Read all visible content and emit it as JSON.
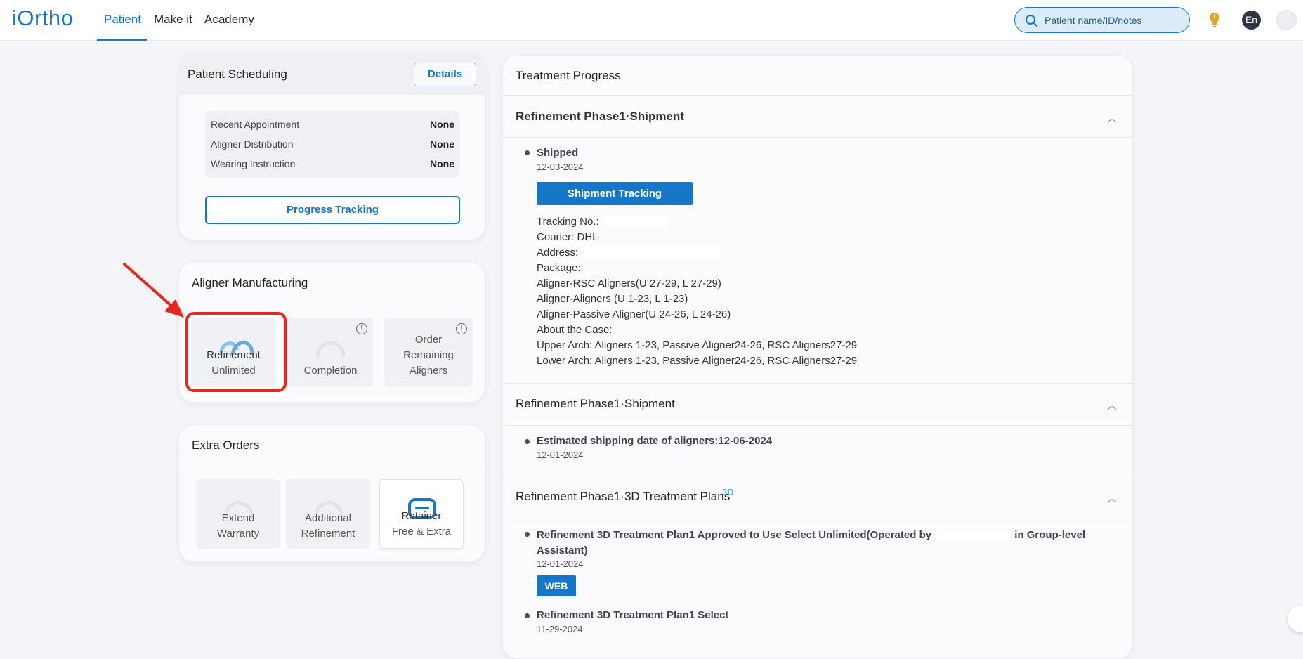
{
  "nav": {
    "logo": "iOrtho",
    "items": [
      "Patient",
      "Make it",
      "Academy"
    ],
    "search_placeholder": "Patient name/ID/notes",
    "lang": "En"
  },
  "scheduling": {
    "title": "Patient Scheduling",
    "details": "Details",
    "rows": [
      {
        "label": "Recent Appointment",
        "value": "None"
      },
      {
        "label": "Aligner Distribution",
        "value": "None"
      },
      {
        "label": "Wearing Instruction",
        "value": "None"
      }
    ],
    "progress_button": "Progress Tracking"
  },
  "manufacturing": {
    "title": "Aligner Manufacturing",
    "tiles": [
      {
        "line1": "Refinement",
        "line2": "Unlimited"
      },
      {
        "line1": "Completion"
      },
      {
        "line1": "Order",
        "line2": "Remaining",
        "line3": "Aligners"
      }
    ]
  },
  "extra": {
    "title": "Extra Orders",
    "tiles": [
      {
        "line1": "Extend",
        "line2": "Warranty"
      },
      {
        "line1": "Additional",
        "line2": "Refinement"
      },
      {
        "line1": "Retainer",
        "line2": "Free & Extra"
      }
    ]
  },
  "progress": {
    "title": "Treatment Progress",
    "sections": [
      {
        "title": "Refinement Phase1·Shipment",
        "event": "Shipped",
        "date": "12-03-2024",
        "button": "Shipment Tracking",
        "lines": {
          "tracking": "Tracking No.:",
          "courier": "Courier: DHL",
          "address": "Address:",
          "package": "Package:",
          "p1": "Aligner-RSC Aligners(U 27-29, L 27-29)",
          "p2": "Aligner-Aligners (U 1-23, L 1-23)",
          "p3": "Aligner-Passive Aligner(U 24-26, L 24-26)",
          "about": "About the Case:",
          "upper": "Upper Arch: Aligners 1-23, Passive Aligner24-26, RSC Aligners27-29",
          "lower": "Lower Arch: Aligners 1-23, Passive Aligner24-26, RSC Aligners27-29"
        }
      },
      {
        "title": "Refinement Phase1·Shipment",
        "event": "Estimated shipping date of aligners:12-06-2024",
        "date": "12-01-2024"
      },
      {
        "title": "Refinement Phase1·3D Treatment Plans",
        "badge": "3D",
        "event1_a": "Refinement 3D Treatment Plan1 Approved to Use Select Unlimited(Operated by",
        "event1_b": "in Group-level",
        "event1_c": "Assistant)",
        "date1": "12-01-2024",
        "button": "WEB",
        "event2": "Refinement 3D Treatment Plan1 Select",
        "date2": "11-29-2024"
      }
    ]
  },
  "colors": {
    "accent": "#1677c9",
    "highlight": "#e5281d"
  }
}
